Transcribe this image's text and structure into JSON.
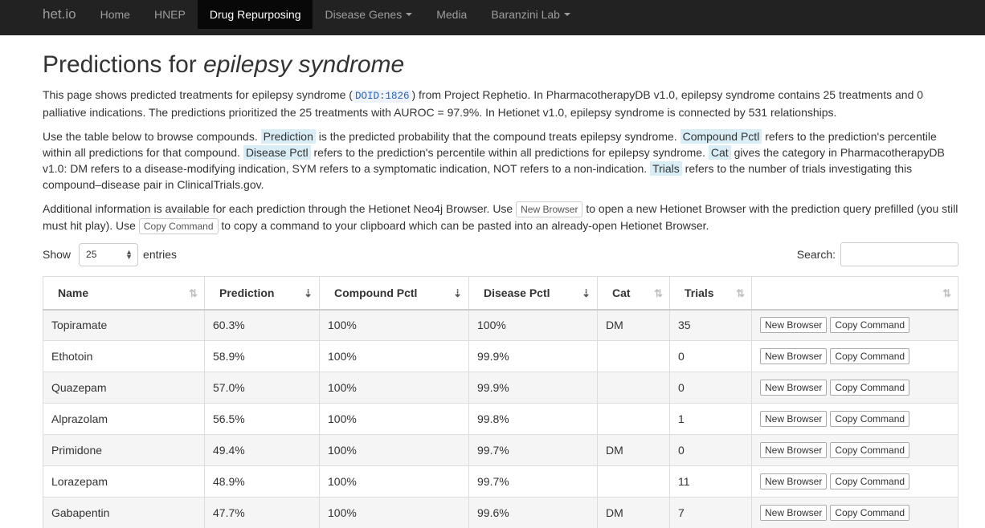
{
  "nav": {
    "brand": "het.io",
    "items": [
      {
        "label": "Home"
      },
      {
        "label": "HNEP"
      },
      {
        "label": "Drug Repurposing"
      },
      {
        "label": "Disease Genes"
      },
      {
        "label": "Media"
      },
      {
        "label": "Baranzini Lab"
      }
    ]
  },
  "page": {
    "title_prefix": "Predictions for ",
    "title_disease": "epilepsy syndrome",
    "p1_a": "This page shows predicted treatments for epilepsy syndrome (",
    "p1_code": "DOID:1826",
    "p1_b": ") from Project Rephetio. In PharmacotherapyDB v1.0, epilepsy syndrome contains 25 treatments and 0 palliative indications. The predictions prioritized the 25 treatments with AUROC = 97.9%. In Hetionet v1.0, epilepsy syndrome is connected by 531 relationships.",
    "p2_a": "Use the table below to browse compounds.",
    "p2_prediction": "Prediction",
    "p2_b": "is the predicted probability that the compound treats epilepsy syndrome.",
    "p2_compound": "Compound Pctl",
    "p2_c": "refers to the prediction's percentile within all predictions for that compound.",
    "p2_disease": "Disease Pctl",
    "p2_d": "refers to the prediction's percentile within all predictions for epilepsy syndrome.",
    "p2_cat": "Cat",
    "p2_e": "gives the category in PharmacotherapyDB v1.0: DM refers to a disease-modifying indication, SYM refers to a symptomatic indication, NOT refers to a non-indication.",
    "p2_trials": "Trials",
    "p2_f": "refers to the number of trials investigating this compound–disease pair in ClinicalTrials.gov.",
    "p3_a": "Additional information is available for each prediction through the Hetionet Neo4j Browser. Use",
    "p3_newbrowser": "New Browser",
    "p3_b": "to open a new Hetionet Browser with the prediction query prefilled (you still must hit play). Use",
    "p3_copycmd": "Copy Command",
    "p3_c": "to copy a command to your clipboard which can be pasted into an already-open Hetionet Browser."
  },
  "controls": {
    "show_label": "Show",
    "entries_value": "25",
    "entries_label": "entries",
    "search_label": "Search:"
  },
  "table": {
    "columns": [
      "Name",
      "Prediction",
      "Compound Pctl",
      "Disease Pctl",
      "Cat",
      "Trials",
      ""
    ],
    "new_browser_label": "New Browser",
    "copy_command_label": "Copy Command",
    "rows": [
      {
        "name": "Topiramate",
        "prediction": "60.3%",
        "compound_pctl": "100%",
        "disease_pctl": "100%",
        "cat": "DM",
        "trials": "35"
      },
      {
        "name": "Ethotoin",
        "prediction": "58.9%",
        "compound_pctl": "100%",
        "disease_pctl": "99.9%",
        "cat": "",
        "trials": "0"
      },
      {
        "name": "Quazepam",
        "prediction": "57.0%",
        "compound_pctl": "100%",
        "disease_pctl": "99.9%",
        "cat": "",
        "trials": "0"
      },
      {
        "name": "Alprazolam",
        "prediction": "56.5%",
        "compound_pctl": "100%",
        "disease_pctl": "99.8%",
        "cat": "",
        "trials": "1"
      },
      {
        "name": "Primidone",
        "prediction": "49.4%",
        "compound_pctl": "100%",
        "disease_pctl": "99.7%",
        "cat": "DM",
        "trials": "0"
      },
      {
        "name": "Lorazepam",
        "prediction": "48.9%",
        "compound_pctl": "100%",
        "disease_pctl": "99.7%",
        "cat": "",
        "trials": "11"
      },
      {
        "name": "Gabapentin",
        "prediction": "47.7%",
        "compound_pctl": "100%",
        "disease_pctl": "99.6%",
        "cat": "DM",
        "trials": "7"
      }
    ]
  }
}
